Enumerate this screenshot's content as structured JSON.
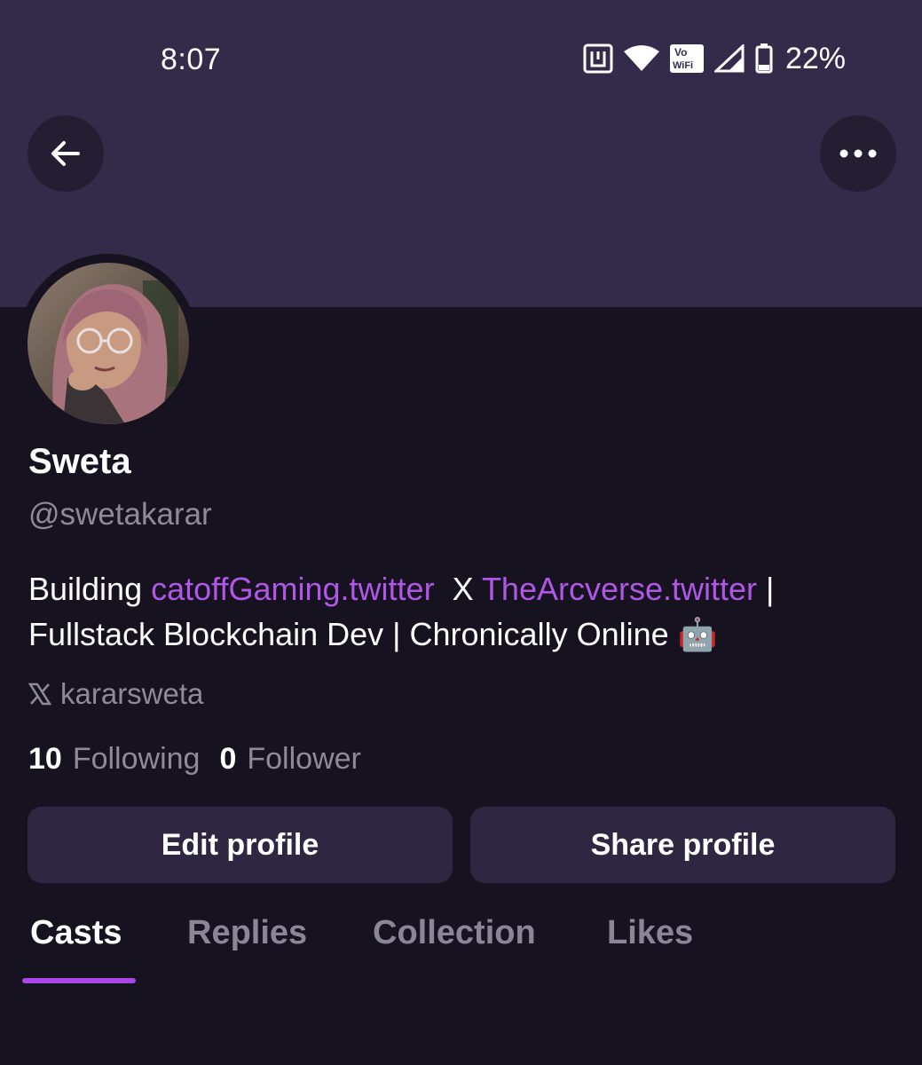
{
  "status_bar": {
    "time": "8:07",
    "battery_percent": "22%",
    "icons": [
      "nfc-icon",
      "wifi-icon",
      "vowifi-icon",
      "signal-icon",
      "battery-icon"
    ],
    "vowifi_top": "Vo",
    "vowifi_bottom": "WiFi"
  },
  "header": {
    "back_icon": "arrow-left-icon",
    "more_icon": "more-horizontal-icon"
  },
  "profile": {
    "display_name": "Sweta",
    "username": "@swetakarar",
    "bio": {
      "part1": "Building ",
      "link1": "catoffGaming.twitter",
      "part2": "  X ",
      "link2": "TheArcverse.twitter",
      "part3": " | Fullstack Blockchain Dev | Chronically Online 🤖"
    },
    "social_icon": "x-logo-icon",
    "social_handle": "kararsweta",
    "following_count": "10",
    "following_label": "Following",
    "follower_count": "0",
    "follower_label": "Follower"
  },
  "actions": {
    "edit_label": "Edit profile",
    "share_label": "Share profile"
  },
  "tabs": [
    {
      "label": "Casts",
      "active": true
    },
    {
      "label": "Replies",
      "active": false
    },
    {
      "label": "Collection",
      "active": false
    },
    {
      "label": "Likes",
      "active": false
    }
  ],
  "colors": {
    "banner": "#342b4a",
    "background": "#17121f",
    "link": "#b057e8",
    "accent": "#a847e8",
    "button": "#2f2741",
    "muted": "#8e8a98"
  }
}
